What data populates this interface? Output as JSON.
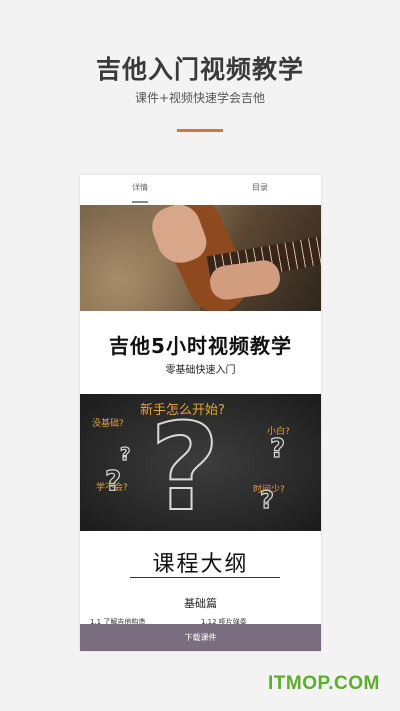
{
  "hero": {
    "title": "吉他入门视频教学",
    "subtitle": "课件+视频快速学会吉他",
    "accent_color": "#d4773a"
  },
  "phone": {
    "tabs": [
      {
        "label": "详情"
      },
      {
        "label": "目录"
      }
    ],
    "course_title": "吉他5小时视频教学",
    "course_subtitle": "零基础快速入门",
    "board": {
      "main_question": "新手怎么开始?",
      "q_basic": "没基础?",
      "q_novice": "小白?",
      "q_learn": "学不会?",
      "q_time": "时间少?"
    },
    "outline_title": "课程大纲",
    "section_title": "基础篇",
    "lessons": [
      {
        "label": "1.1 了解吉他构造"
      },
      {
        "label": "1.12 哑片弹奏"
      }
    ],
    "download_button": "下载课件",
    "download_color": "#7a6d80"
  },
  "watermark": "ITMOP.COM"
}
